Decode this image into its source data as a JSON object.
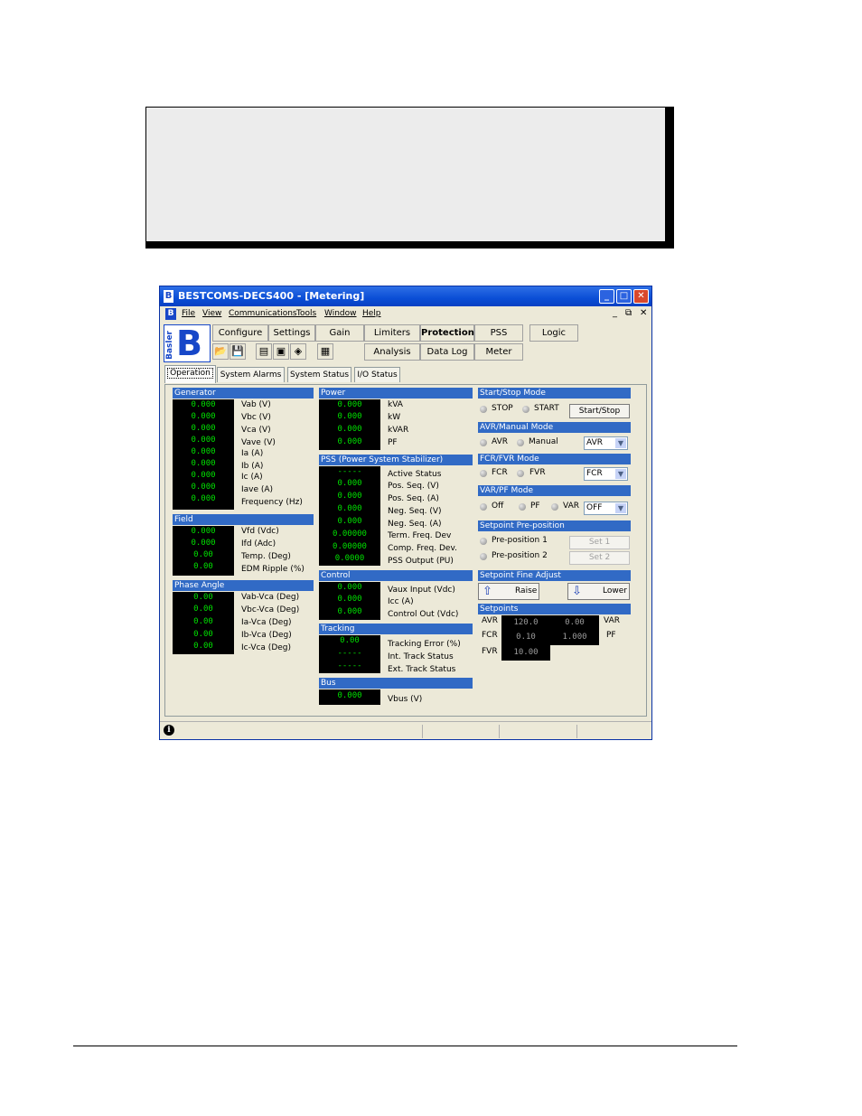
{
  "window": {
    "title": "BESTCOMS-DECS400 - [Metering]",
    "logo_letter": "B",
    "controls": {
      "minimize": "_",
      "maximize": "□",
      "close": "✕"
    }
  },
  "menu": {
    "items": [
      "File",
      "View",
      "Communications",
      "Tools",
      "Window",
      "Help"
    ],
    "mdi": {
      "minimize": "_",
      "restore": "⧉",
      "close": "✕"
    }
  },
  "brand": {
    "word": "Basler",
    "letter": "B"
  },
  "toolbar": {
    "configure": "Configure",
    "settings": "Settings",
    "gain": "Gain",
    "limiters": "Limiters",
    "protection": "Protection",
    "pss": "PSS",
    "logic": "Logic",
    "analysis": "Analysis",
    "data_log": "Data Log",
    "meter": "Meter"
  },
  "tabs": [
    "Operation",
    "System Alarms",
    "System Status",
    "I/O Status"
  ],
  "generator": {
    "header": "Generator",
    "values": [
      "0.000",
      "0.000",
      "0.000",
      "0.000",
      "0.000",
      "0.000",
      "0.000",
      "0.000",
      "0.000"
    ],
    "labels": [
      "Vab (V)",
      "Vbc (V)",
      "Vca (V)",
      "Vave (V)",
      "Ia (A)",
      "Ib (A)",
      "Ic (A)",
      "Iave (A)",
      "Frequency (Hz)"
    ]
  },
  "field": {
    "header": "Field",
    "values": [
      "0.000",
      "0.000",
      "0.00",
      "0.00"
    ],
    "labels": [
      "Vfd (Vdc)",
      "Ifd (Adc)",
      "Temp. (Deg)",
      "EDM Ripple (%)"
    ]
  },
  "phase_angle": {
    "header": "Phase Angle",
    "values": [
      "0.00",
      "0.00",
      "0.00",
      "0.00",
      "0.00"
    ],
    "labels": [
      "Vab-Vca (Deg)",
      "Vbc-Vca (Deg)",
      "Ia-Vca (Deg)",
      "Ib-Vca (Deg)",
      "Ic-Vca (Deg)"
    ]
  },
  "power": {
    "header": "Power",
    "values": [
      "0.000",
      "0.000",
      "0.000",
      "0.000"
    ],
    "labels": [
      "kVA",
      "kW",
      "kVAR",
      "PF"
    ]
  },
  "pss": {
    "header": "PSS (Power System Stabilizer)",
    "values": [
      "-----",
      "0.000",
      "0.000",
      "0.000",
      "0.000",
      "0.00000",
      "0.00000",
      "0.0000"
    ],
    "labels": [
      "Active Status",
      "Pos. Seq. (V)",
      "Pos. Seq. (A)",
      "Neg. Seq. (V)",
      "Neg. Seq. (A)",
      "Term. Freq. Dev",
      "Comp. Freq. Dev.",
      "PSS Output (PU)"
    ]
  },
  "control": {
    "header": "Control",
    "values": [
      "0.000",
      "0.000",
      "0.000"
    ],
    "labels": [
      "Vaux Input (Vdc)",
      "Icc (A)",
      "Control Out (Vdc)"
    ]
  },
  "tracking": {
    "header": "Tracking",
    "values": [
      "0.00",
      "-----",
      "-----"
    ],
    "labels": [
      "Tracking Error (%)",
      "Int. Track Status",
      "Ext. Track Status"
    ]
  },
  "bus": {
    "header": "Bus",
    "values": [
      "0.000"
    ],
    "labels": [
      "Vbus (V)"
    ]
  },
  "start_stop": {
    "header": "Start/Stop Mode",
    "stop": "STOP",
    "start": "START",
    "button": "Start/Stop"
  },
  "avr_manual": {
    "header": "AVR/Manual Mode",
    "avr": "AVR",
    "manual": "Manual",
    "select": "AVR"
  },
  "fcr_fvr": {
    "header": "FCR/FVR Mode",
    "fcr": "FCR",
    "fvr": "FVR",
    "select": "FCR"
  },
  "var_pf": {
    "header": "VAR/PF Mode",
    "off": "Off",
    "pf": "PF",
    "var": "VAR",
    "select": "OFF"
  },
  "preposition": {
    "header": "Setpoint Pre-position",
    "p1": "Pre-position 1",
    "p2": "Pre-position 2",
    "set1": "Set 1",
    "set2": "Set 2"
  },
  "fine_adjust": {
    "header": "Setpoint Fine Adjust",
    "raise": "Raise",
    "lower": "Lower"
  },
  "setpoints": {
    "header": "Setpoints",
    "avr_label": "AVR",
    "fcr_label": "FCR",
    "fvr_label": "FVR",
    "var_label": "VAR",
    "pf_label": "PF",
    "avr": "120.0",
    "fcr": "0.10",
    "fvr": "10.00",
    "var": "0.00",
    "pf": "1.000"
  },
  "status_bar": {
    "icon": "i"
  }
}
